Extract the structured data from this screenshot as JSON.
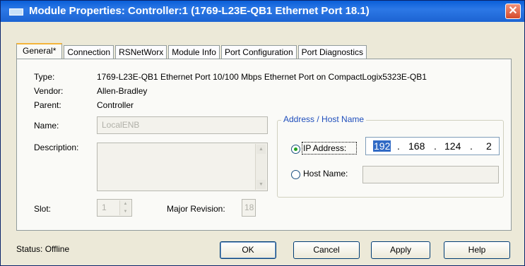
{
  "window": {
    "title": "Module Properties: Controller:1 (1769-L23E-QB1 Ethernet Port 18.1)"
  },
  "title_icon": "module-icon",
  "close_icon": "close-icon",
  "close_glyph": "✕",
  "tabs": [
    {
      "label": "General*",
      "active": true
    },
    {
      "label": "Connection"
    },
    {
      "label": "RSNetWorx"
    },
    {
      "label": "Module Info"
    },
    {
      "label": "Port Configuration"
    },
    {
      "label": "Port Diagnostics"
    }
  ],
  "general": {
    "type_label": "Type:",
    "type_value": "1769-L23E-QB1 Ethernet Port 10/100 Mbps Ethernet Port on CompactLogix5323E-QB1",
    "vendor_label": "Vendor:",
    "vendor_value": "Allen-Bradley",
    "parent_label": "Parent:",
    "parent_value": "Controller",
    "name_label": "Name:",
    "name_value": "LocalENB",
    "description_label": "Description:",
    "description_value": "",
    "slot_label": "Slot:",
    "slot_value": "1",
    "major_revision_label": "Major Revision:",
    "major_revision_value": "18"
  },
  "address": {
    "group_title": "Address / Host Name",
    "ip_label": "IP Address:",
    "ip_octets": [
      "192",
      "168",
      "124",
      "2"
    ],
    "ip_separator": ".",
    "ip_selected": true,
    "host_label": "Host Name:",
    "host_value": "",
    "host_selected": false
  },
  "status": {
    "text": "Status:  Offline"
  },
  "buttons": {
    "ok": "OK",
    "cancel": "Cancel",
    "apply": "Apply",
    "help": "Help"
  },
  "colors": {
    "titlebar": "#0a5fd8",
    "background": "#ece9d8",
    "group_title": "#1f4ebc",
    "selection": "#316ac5"
  }
}
